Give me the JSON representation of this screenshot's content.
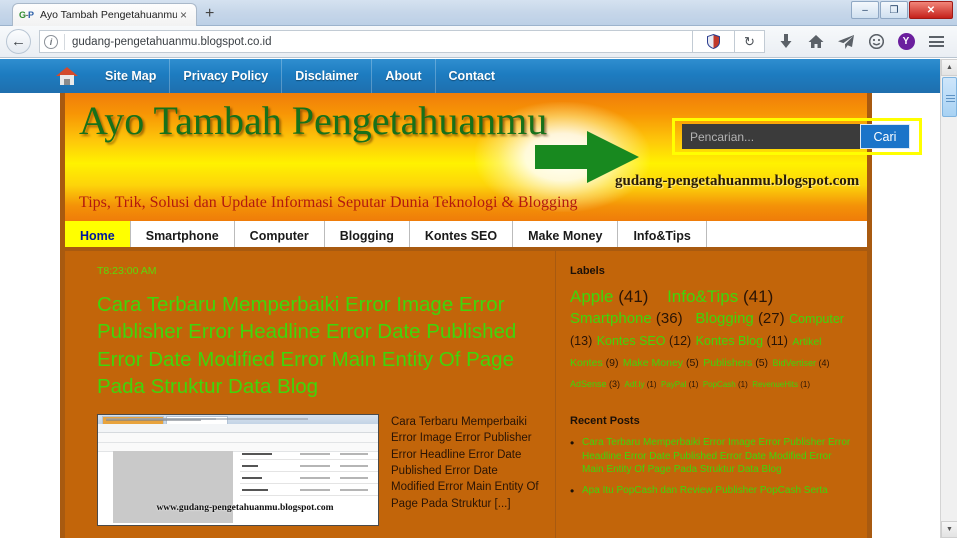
{
  "browser": {
    "tab": {
      "favicon": "G-P",
      "title": "Ayo Tambah Pengetahuanmu",
      "close": "×"
    },
    "newtab_label": "+",
    "window_controls": {
      "minimize": "–",
      "restore": "❐",
      "close": "✕"
    },
    "back_arrow": "←",
    "url": "gudang-pengetahuanmu.blogspot.co.id",
    "info_icon": "i",
    "reload_icon": "↻",
    "toolbar_icons": [
      {
        "name": "download-icon",
        "glyph": "⬇"
      },
      {
        "name": "home-icon",
        "glyph": "⌂"
      },
      {
        "name": "pocket-icon",
        "glyph": "➤"
      },
      {
        "name": "smiley-feedback-icon",
        "glyph": "☺"
      }
    ],
    "avatar_letter": "Y"
  },
  "topnav": {
    "home_icon": "home-icon",
    "items": [
      {
        "label": "Site Map"
      },
      {
        "label": "Privacy Policy"
      },
      {
        "label": "Disclaimer"
      },
      {
        "label": "About"
      },
      {
        "label": "Contact"
      }
    ]
  },
  "search": {
    "placeholder": "Pencarian...",
    "value": "",
    "button_label": "Cari",
    "highlight_color": "#ffff00"
  },
  "banner": {
    "title": "Ayo Tambah Pengetahuanmu",
    "subtitle": "Tips, Trik, Solusi dan Update Informasi Seputar Dunia Teknologi & Blogging",
    "site_url": "gudang-pengetahuanmu.blogspot.com"
  },
  "menu": {
    "items": [
      {
        "label": "Home",
        "active": true
      },
      {
        "label": "Smartphone",
        "active": false
      },
      {
        "label": "Computer",
        "active": false
      },
      {
        "label": "Blogging",
        "active": false
      },
      {
        "label": "Kontes SEO",
        "active": false
      },
      {
        "label": "Make Money",
        "active": false
      },
      {
        "label": "Info&Tips",
        "active": false
      }
    ]
  },
  "post": {
    "time": "T8:23:00 AM",
    "title": "Cara Terbaru Memperbaiki Error Image Error Publisher Error Headline Error Date Published Error Date Modified Error Main Entity Of Page Pada Struktur Data Blog",
    "thumbnail_watermark": "www.gudang-pengetahuanmu.blogspot.com",
    "excerpt": "Cara Terbaru Memperbaiki Error Image Error Publisher Error Headline Error Date Published Error Date Modified Error Main Entity Of Page Pada Struktur [...]"
  },
  "sidebar": {
    "labels_heading": "Labels",
    "labels": [
      {
        "name": "Apple",
        "count": "(41)",
        "size": "lb-1"
      },
      {
        "name": "Info&Tips",
        "count": "(41)",
        "size": "lb-1"
      },
      {
        "name": "Smartphone",
        "count": "(36)",
        "size": "lb-2"
      },
      {
        "name": "Blogging",
        "count": "(27)",
        "size": "lb-2"
      },
      {
        "name": "Computer",
        "count": "(13)",
        "size": "lb-3"
      },
      {
        "name": "Kontes SEO",
        "count": "(12)",
        "size": "lb-3"
      },
      {
        "name": "Kontes Blog",
        "count": "(11)",
        "size": "lb-3"
      },
      {
        "name": "Artikel Kontes",
        "count": "(9)",
        "size": "lb-4"
      },
      {
        "name": "Make Money",
        "count": "(5)",
        "size": "lb-4"
      },
      {
        "name": "Publishers",
        "count": "(5)",
        "size": "lb-4"
      },
      {
        "name": "BidVertiser",
        "count": "(4)",
        "size": "lb-5"
      },
      {
        "name": "AdSense",
        "count": "(3)",
        "size": "lb-5"
      },
      {
        "name": "Adf.ly",
        "count": "(1)",
        "size": "lb-6"
      },
      {
        "name": "PayPal",
        "count": "(1)",
        "size": "lb-6"
      },
      {
        "name": "PopCash",
        "count": "(1)",
        "size": "lb-6"
      },
      {
        "name": "RevenueHits",
        "count": "(1)",
        "size": "lb-6"
      }
    ],
    "recent_heading": "Recent Posts",
    "recent_posts": [
      {
        "title": "Cara Terbaru Memperbaiki Error Image Error Publisher Error Headline Error Date Published Error Date Modified Error Main Entity Of Page Pada Struktur Data Blog"
      },
      {
        "title": "Apa Itu PopCash dan Review Publisher PopCash Serta"
      }
    ]
  },
  "scrollbar": {
    "up": "▲",
    "down": "▼"
  }
}
